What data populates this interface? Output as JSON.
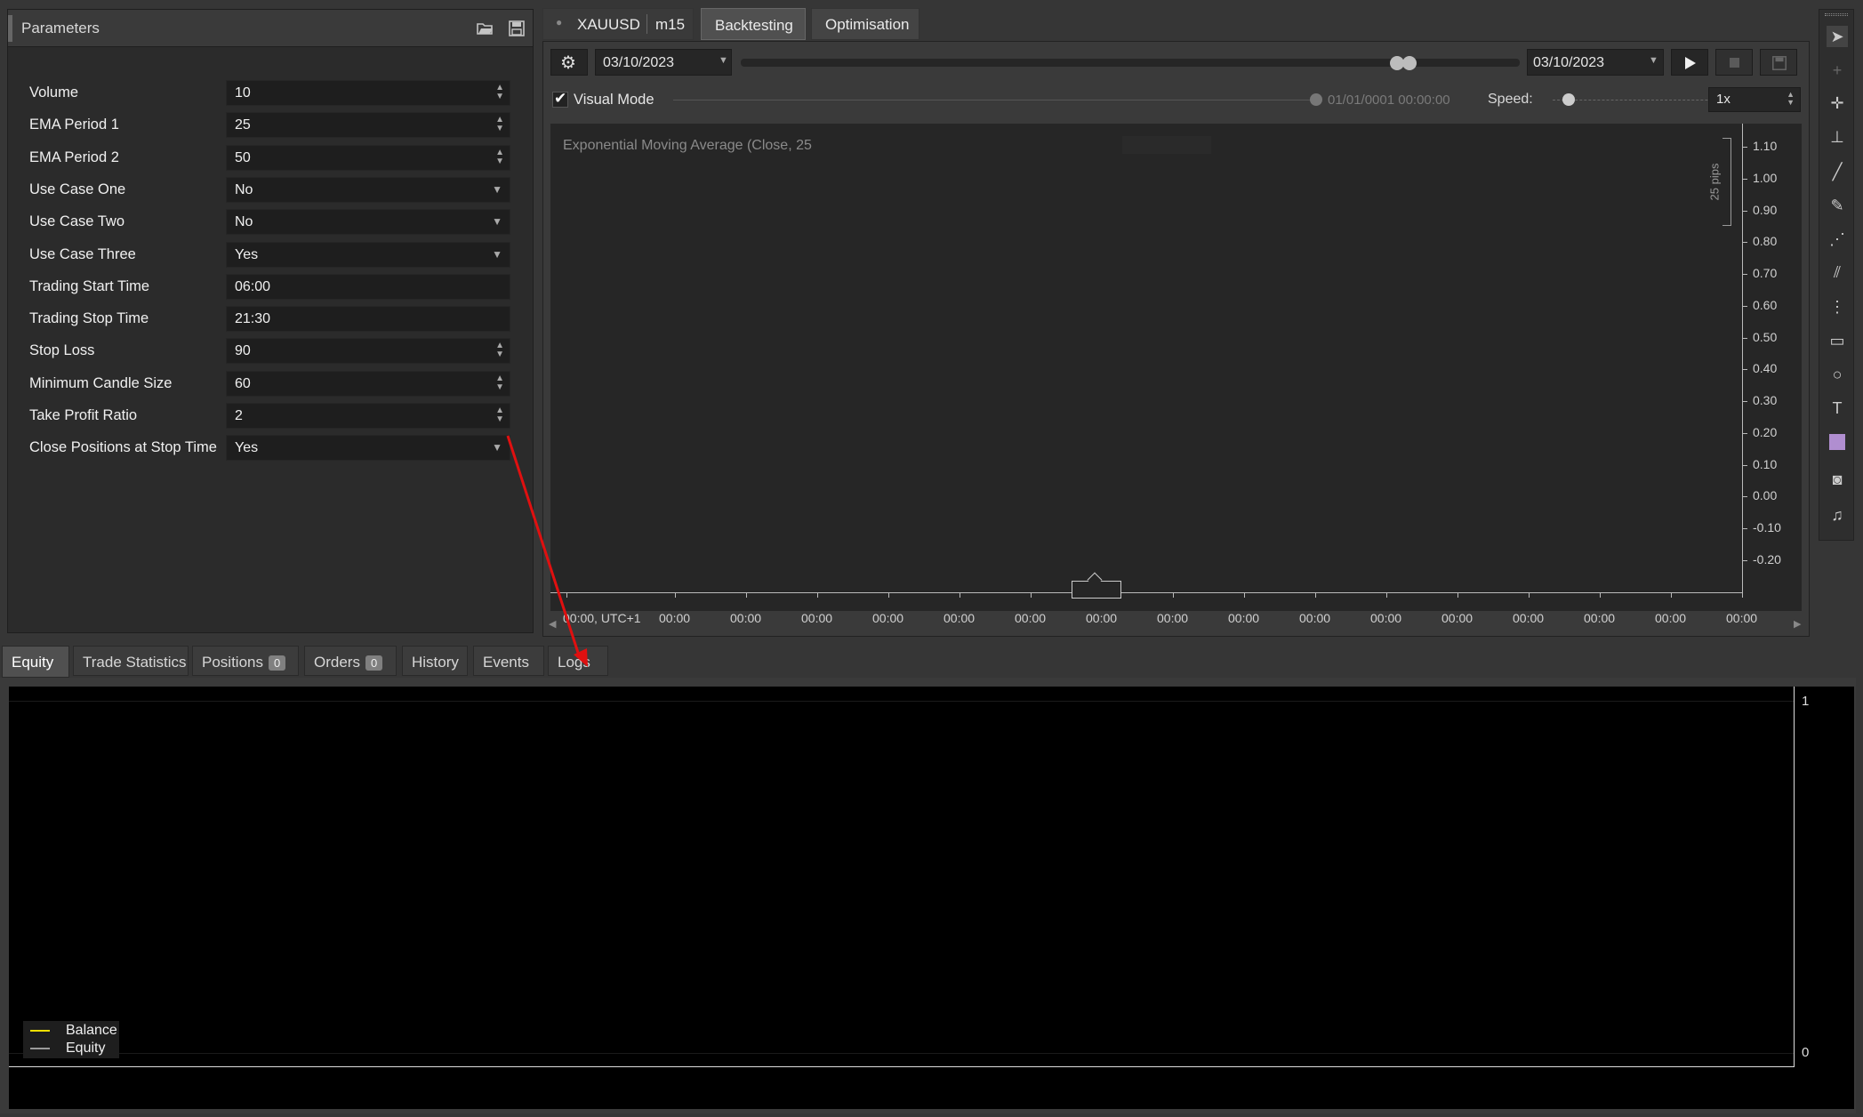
{
  "parameters": {
    "title": "Parameters",
    "rows": [
      {
        "label": "Volume",
        "value": "10",
        "kind": "spin"
      },
      {
        "label": "EMA Period 1",
        "value": "25",
        "kind": "spin"
      },
      {
        "label": "EMA Period 2",
        "value": "50",
        "kind": "spin"
      },
      {
        "label": "Use Case One",
        "value": "No",
        "kind": "select"
      },
      {
        "label": "Use Case Two",
        "value": "No",
        "kind": "select"
      },
      {
        "label": "Use Case Three",
        "value": "Yes",
        "kind": "select"
      },
      {
        "label": "Trading Start Time",
        "value": "06:00",
        "kind": "text"
      },
      {
        "label": "Trading Stop Time",
        "value": "21:30",
        "kind": "text"
      },
      {
        "label": "Stop Loss",
        "value": "90",
        "kind": "spin"
      },
      {
        "label": "Minimum Candle Size",
        "value": "60",
        "kind": "spin"
      },
      {
        "label": "Take Profit Ratio",
        "value": "2",
        "kind": "spin"
      },
      {
        "label": "Close Positions at Stop Time",
        "value": "Yes",
        "kind": "select"
      }
    ]
  },
  "top_tabs": {
    "symbol": "XAUUSD",
    "timeframe": "m15",
    "backtesting": "Backtesting",
    "optimisation": "Optimisation"
  },
  "toolbar": {
    "start_date": "03/10/2023",
    "end_date": "03/10/2023",
    "visual_mode_label": "Visual Mode",
    "visual_mode_checked": true,
    "progress_time": "01/01/0001 00:00:00",
    "speed_label": "Speed:",
    "speed_value": "1x"
  },
  "chart": {
    "indicator_label": "Exponential Moving Average (Close, 25",
    "pips_label": "25 pips",
    "y_ticks": [
      "1.10",
      "1.00",
      "0.90",
      "0.80",
      "0.70",
      "0.60",
      "0.50",
      "0.40",
      "0.30",
      "0.20",
      "0.10",
      "0.00",
      "-0.10",
      "-0.20"
    ],
    "x_ticks": [
      "00:00, UTC+1",
      "00:00",
      "00:00",
      "00:00",
      "00:00",
      "00:00",
      "00:00",
      "00:00",
      "00:00",
      "00:00",
      "00:00",
      "00:00",
      "00:00",
      "00:00",
      "00:00",
      "00:00",
      "00:00"
    ]
  },
  "bottom_tabs": [
    {
      "label": "Equity",
      "badge": null
    },
    {
      "label": "Trade Statistics",
      "badge": null
    },
    {
      "label": "Positions",
      "badge": "0"
    },
    {
      "label": "Orders",
      "badge": "0"
    },
    {
      "label": "History",
      "badge": null
    },
    {
      "label": "Events",
      "badge": null
    },
    {
      "label": "Logs",
      "badge": null
    }
  ],
  "equity_chart": {
    "y_top": "1",
    "y_bottom": "0",
    "legend": [
      {
        "name": "Balance",
        "color": "#f0e000"
      },
      {
        "name": "Equity",
        "color": "#9a9a9a"
      }
    ]
  },
  "colors": {
    "annotation_arrow": "#e01010",
    "accent": "#ffffff"
  }
}
